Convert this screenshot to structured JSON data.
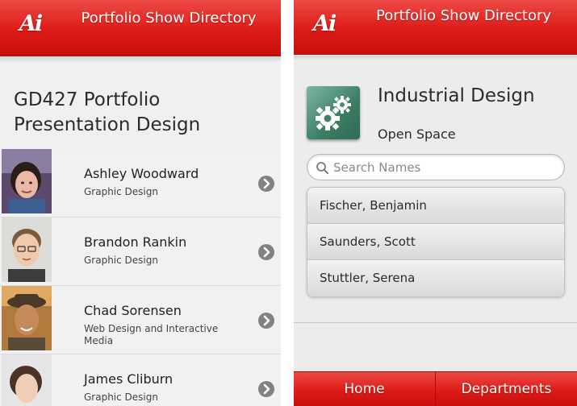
{
  "app": {
    "logo_text": "Ai",
    "title": "Portfolio Show Directory",
    "accent_color": "#dd1b17"
  },
  "left_screen": {
    "course_title": "GD427 Portfolio Presentation Design",
    "students": [
      {
        "name": "Ashley Woodward",
        "department": "Graphic Design"
      },
      {
        "name": "Brandon Rankin",
        "department": "Graphic Design"
      },
      {
        "name": "Chad Sorensen",
        "department": "Web Design and Interactive Media"
      },
      {
        "name": "James Cliburn",
        "department": "Graphic Design"
      }
    ],
    "row_icon": "chevron-right-icon"
  },
  "right_screen": {
    "department_icon": "gears-icon",
    "department_title": "Industrial Design",
    "location": "Open Space",
    "search": {
      "placeholder": "Search Names",
      "value": ""
    },
    "names": [
      "Fischer, Benjamin",
      "Saunders, Scott",
      "Stuttler, Serena"
    ],
    "tabs": [
      {
        "label": "Home"
      },
      {
        "label": "Departments"
      }
    ]
  }
}
